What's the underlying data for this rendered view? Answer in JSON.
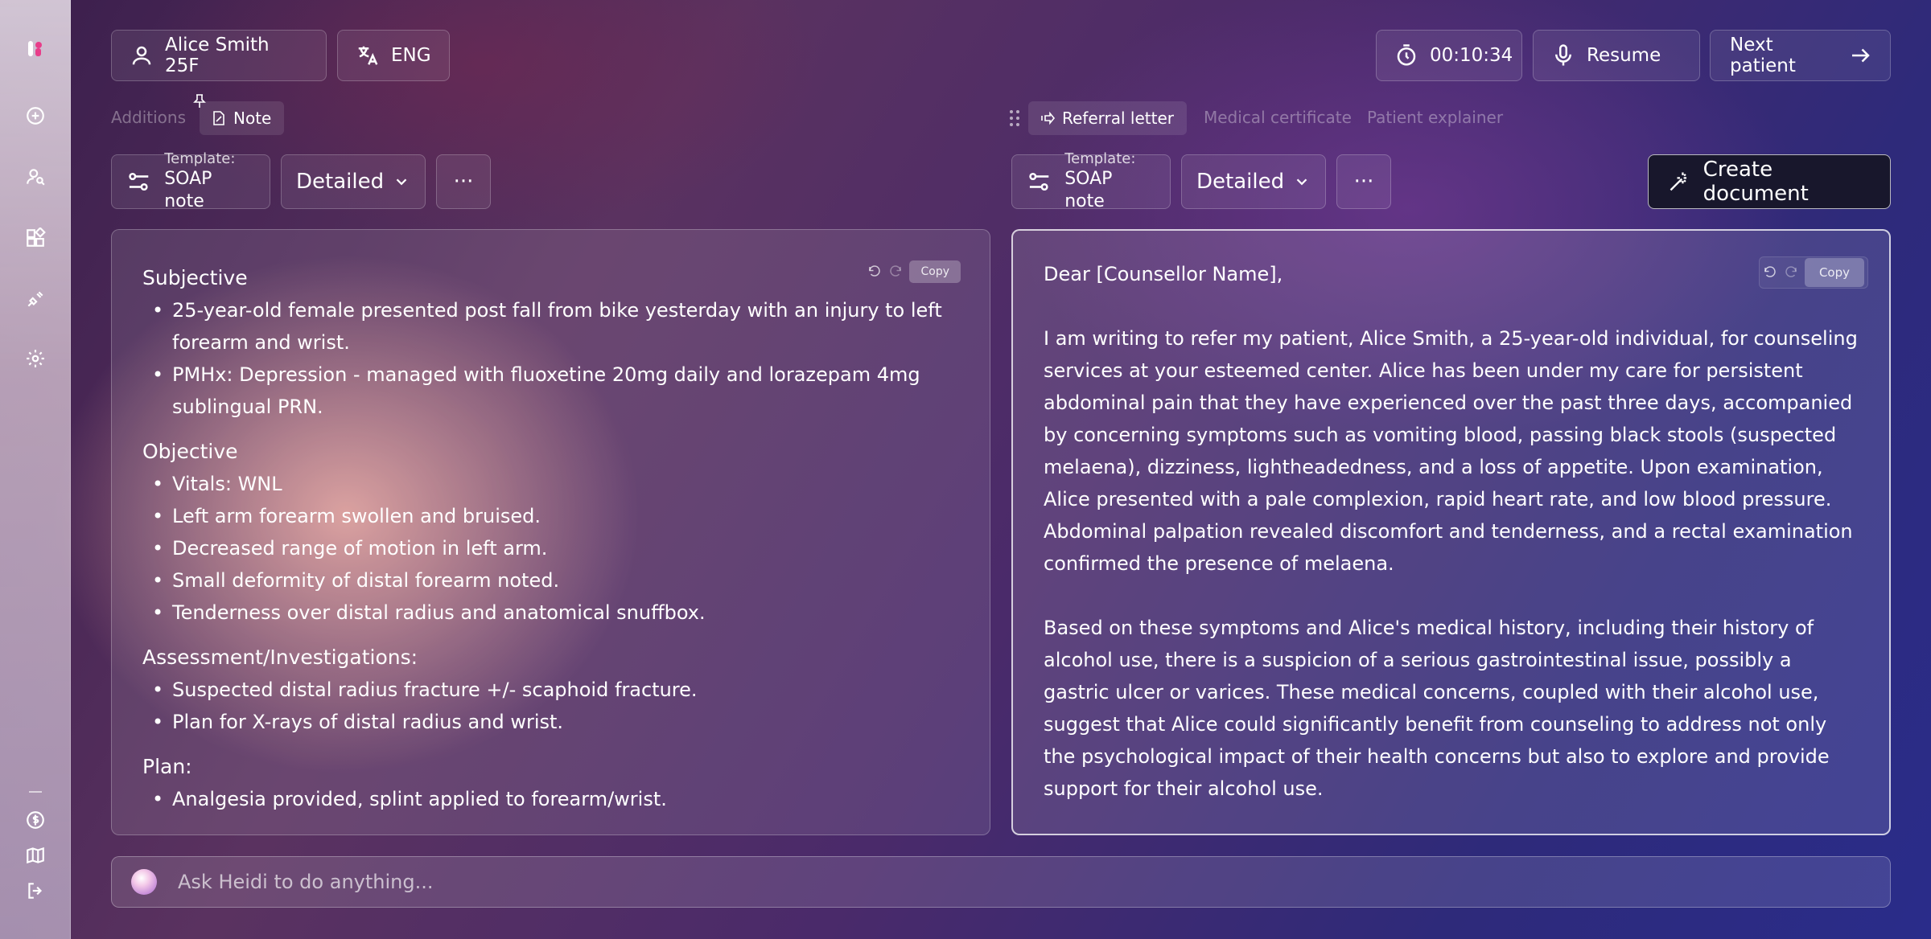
{
  "header": {
    "patient": "Alice Smith 25F",
    "language": "ENG",
    "timer": "00:10:34",
    "resume_label": "Resume",
    "next_label": "Next patient"
  },
  "left_tabs": {
    "additions": "Additions",
    "note": "Note"
  },
  "right_tabs": {
    "referral": "Referral letter",
    "certificate": "Medical certificate",
    "explainer": "Patient explainer"
  },
  "left_controls": {
    "template_caption": "Template:",
    "template_name": "SOAP note",
    "detail": "Detailed",
    "more": "···"
  },
  "right_controls": {
    "template_caption": "Template:",
    "template_name": "SOAP note",
    "detail": "Detailed",
    "more": "···",
    "create_label": "Create document"
  },
  "note": {
    "copy_label": "Copy",
    "sections": [
      {
        "heading": "Subjective",
        "items": [
          "25-year-old female presented post fall from bike yesterday with an injury to left forearm and wrist.",
          "PMHx: Depression - managed with fluoxetine 20mg daily and lorazepam 4mg sublingual PRN."
        ]
      },
      {
        "heading": "Objective",
        "items": [
          "Vitals: WNL",
          "Left arm forearm swollen and bruised.",
          "Decreased range of motion in left arm.",
          "Small deformity of distal forearm noted.",
          "Tenderness over distal radius and anatomical snuffbox."
        ]
      },
      {
        "heading": "Assessment/Investigations:",
        "items": [
          "Suspected distal radius fracture +/- scaphoid fracture.",
          "Plan for X-rays of distal radius and wrist."
        ]
      },
      {
        "heading": "Plan:",
        "items": [
          "Analgesia provided, splint applied to forearm/wrist."
        ]
      }
    ]
  },
  "letter": {
    "copy_label": "Copy",
    "greeting": "Dear [Counsellor Name],",
    "paragraph1": "I am writing to refer my patient, Alice Smith, a 25-year-old individual, for counseling services at your esteemed center. Alice has been under my care for persistent abdominal pain that they have experienced over the past three days, accompanied by concerning symptoms such as vomiting blood, passing black stools (suspected melaena), dizziness, lightheadedness, and a loss of appetite. Upon examination, Alice presented with a pale complexion, rapid heart rate, and low blood pressure. Abdominal palpation revealed discomfort and tenderness, and a rectal examination confirmed the presence of melaena.",
    "paragraph2": "Based on these symptoms and Alice's medical history, including their history of alcohol use, there is a suspicion of a serious gastrointestinal issue, possibly a gastric ulcer or varices. These medical concerns, coupled with their alcohol use, suggest that Alice could significantly benefit from counseling to address not only the psychological impact of their health concerns but also to explore and provide support for their alcohol use."
  },
  "ask": {
    "placeholder": "Ask Heidi to do anything..."
  }
}
